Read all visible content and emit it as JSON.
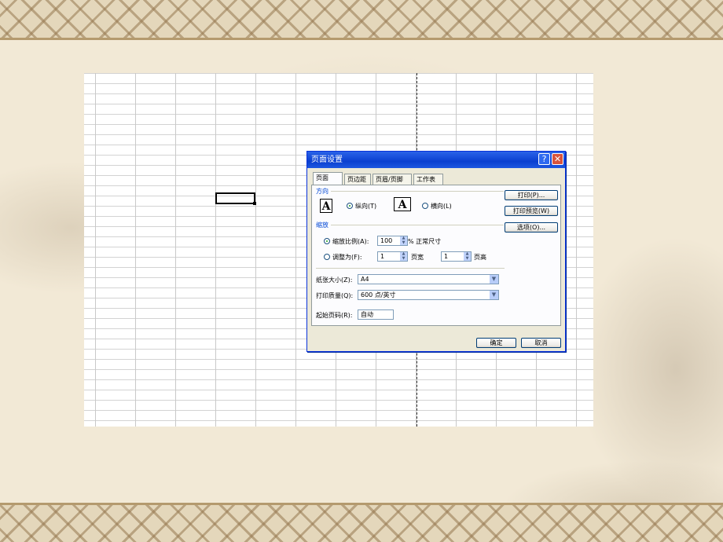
{
  "dialog": {
    "title": "页面设置",
    "help_glyph": "?",
    "close_glyph": "✕",
    "tabs": [
      {
        "label": "页面"
      },
      {
        "label": "页边距"
      },
      {
        "label": "页眉/页脚"
      },
      {
        "label": "工作表"
      }
    ],
    "orientation": {
      "section_label": "方向",
      "portrait_label": "纵向(T)",
      "landscape_label": "横向(L)",
      "icon_glyph": "A",
      "selected": "portrait"
    },
    "scaling": {
      "section_label": "缩放",
      "adjust_label": "缩放比例(A):",
      "adjust_value": "100",
      "adjust_suffix": "% 正常尺寸",
      "fit_label": "调整为(F):",
      "fit_wide_value": "1",
      "fit_wide_suffix": "页宽",
      "fit_tall_value": "1",
      "fit_tall_suffix": "页高",
      "selected": "adjust"
    },
    "paper_size": {
      "label": "纸张大小(Z):",
      "value": "A4"
    },
    "print_quality": {
      "label": "打印质量(Q):",
      "value": "600 点/英寸"
    },
    "first_page": {
      "label": "起始页码(R):",
      "value": "自动"
    },
    "side_buttons": {
      "print": "打印(P)...",
      "preview": "打印预览(W)",
      "options": "选项(O)..."
    },
    "ok_label": "确定",
    "cancel_label": "取消"
  }
}
